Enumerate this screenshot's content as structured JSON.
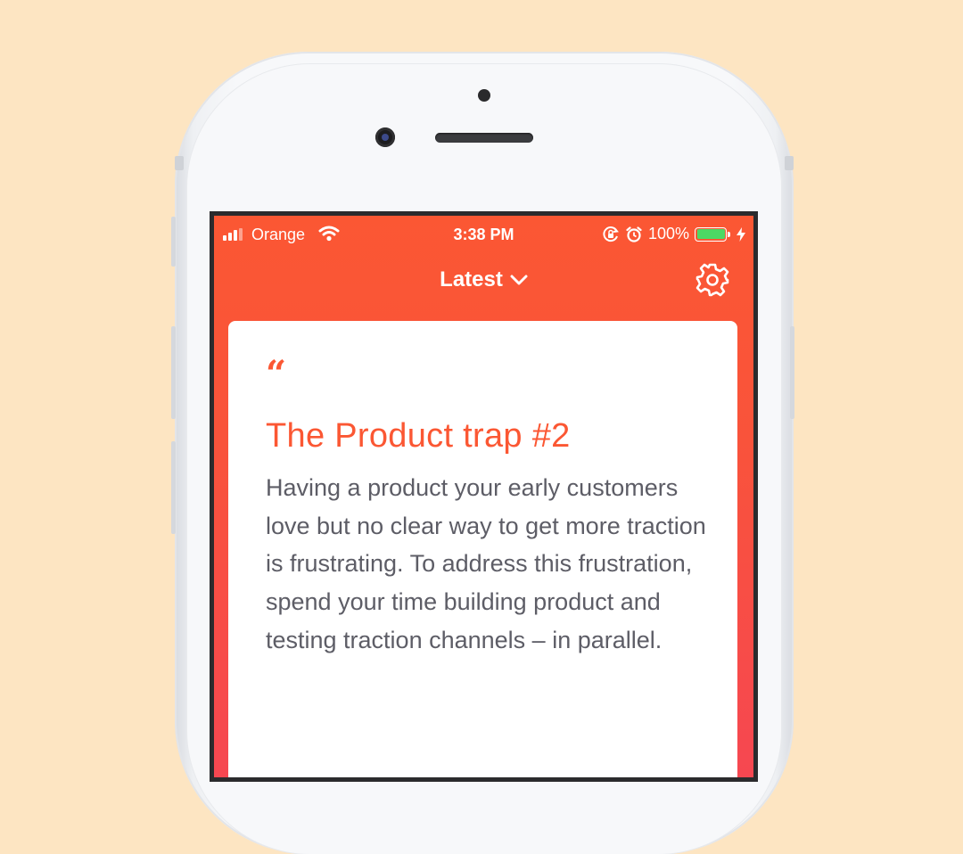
{
  "status_bar": {
    "carrier": "Orange",
    "time": "3:38 PM",
    "battery_percent": "100%",
    "icons": [
      "signal-icon",
      "wifi-icon",
      "orientation-lock-icon",
      "alarm-icon",
      "battery-icon",
      "charging-bolt-icon"
    ]
  },
  "nav": {
    "title": "Latest",
    "title_icon": "chevron-down-icon",
    "settings_icon": "gear-icon"
  },
  "card": {
    "quote_mark": "“",
    "title": "The Product trap #2",
    "body": "Having a product your early customers love but no clear way to get more traction is frustrating. To address this frustration, spend your time building product and testing traction channels – in parallel."
  },
  "colors": {
    "accent": "#fb5733",
    "background": "#fde5c2",
    "body_text": "#5d5d66",
    "battery": "#4cd964"
  }
}
